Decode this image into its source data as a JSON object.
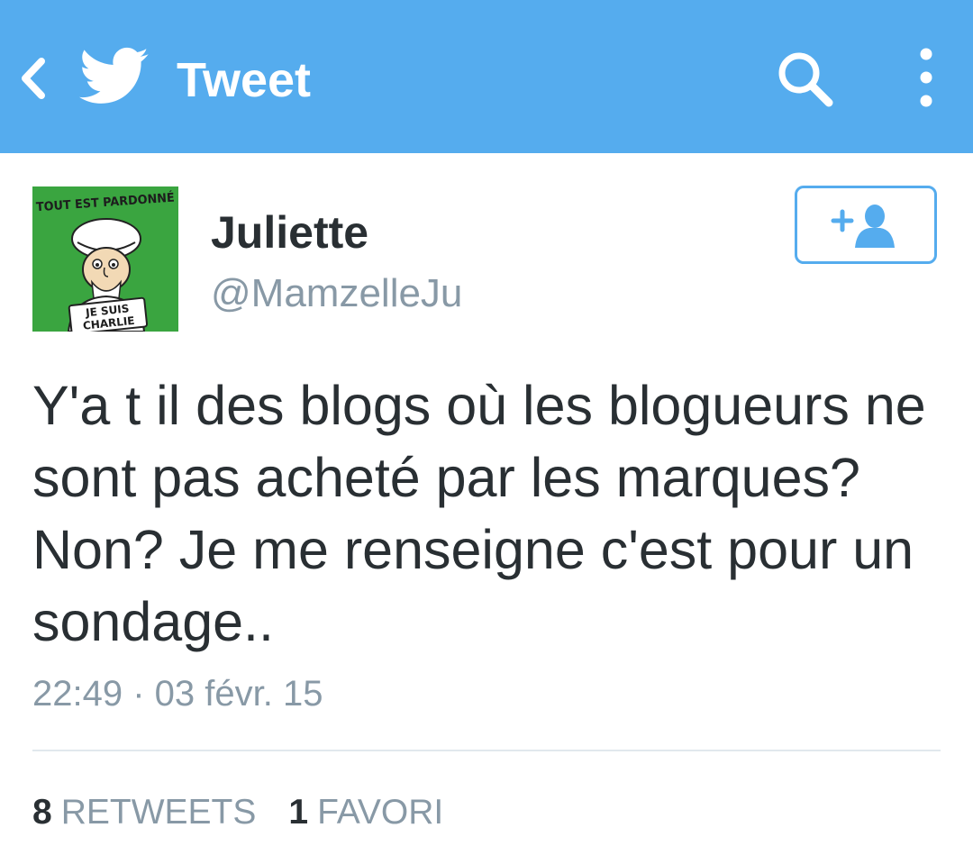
{
  "colors": {
    "bar_bg": "#55acee",
    "bar_fg": "#ffffff",
    "text_primary": "#292f33",
    "text_secondary": "#8899a6",
    "divider": "#e1e8ed",
    "avatar_bg": "#3aa540"
  },
  "header": {
    "title": "Tweet",
    "icons": [
      "back-chevron-icon",
      "twitter-bird-icon",
      "search-icon",
      "overflow-menu-icon"
    ]
  },
  "avatar": {
    "caption_top": "TOUT EST PARDONNÉ",
    "sign_line1": "JE SUIS",
    "sign_line2": "CHARLIE"
  },
  "user": {
    "name": "Juliette",
    "handle": "@MamzelleJu",
    "follow_icon": "add-user-icon"
  },
  "tweet": {
    "text": "Y'a t il des blogs où les blogueurs ne sont pas acheté par les marques? Non? Je me renseigne c'est pour un sondage..",
    "timestamp": "22:49 · 03 févr. 15"
  },
  "stats": {
    "retweets_count": "8",
    "retweets_label": "RETWEETS",
    "favorites_count": "1",
    "favorites_label": "FAVORI"
  }
}
